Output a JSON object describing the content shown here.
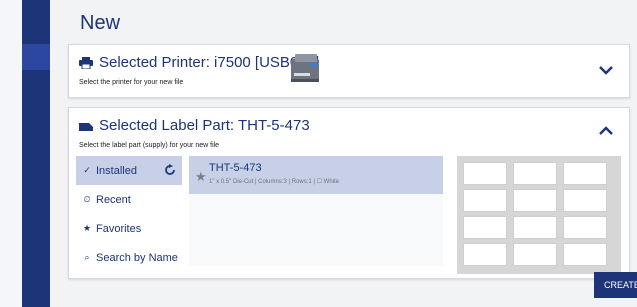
{
  "page": {
    "title": "New"
  },
  "printer_card": {
    "title": "Selected Printer: i7500 [USB001]",
    "subtitle": "Select the printer for your new file",
    "icon": "printer-icon",
    "expand_icon": "chevron-down-icon"
  },
  "label_card": {
    "title": "Selected Label Part: THT-5-473",
    "subtitle": "Select the label part (supply) for your new file",
    "icon": "label-icon",
    "collapse_icon": "chevron-up-icon",
    "filters": [
      {
        "label": "Installed",
        "icon": "check-icon",
        "active": true
      },
      {
        "label": "Recent",
        "icon": "clock-icon",
        "active": false
      },
      {
        "label": "Favorites",
        "icon": "star-icon",
        "active": false
      },
      {
        "label": "Search by Name",
        "icon": "search-icon",
        "active": false
      }
    ],
    "parts": [
      {
        "name": "THT-5-473",
        "description": "1\" x 0.5\" Die-Cut  |  Columns:3  |  Rows:1  |  ☐ White"
      }
    ]
  },
  "create_button": {
    "label": "CREATE"
  },
  "colors": {
    "accent": "#1d3478",
    "selection": "#c7d0e6",
    "background": "#f2f3f5"
  }
}
